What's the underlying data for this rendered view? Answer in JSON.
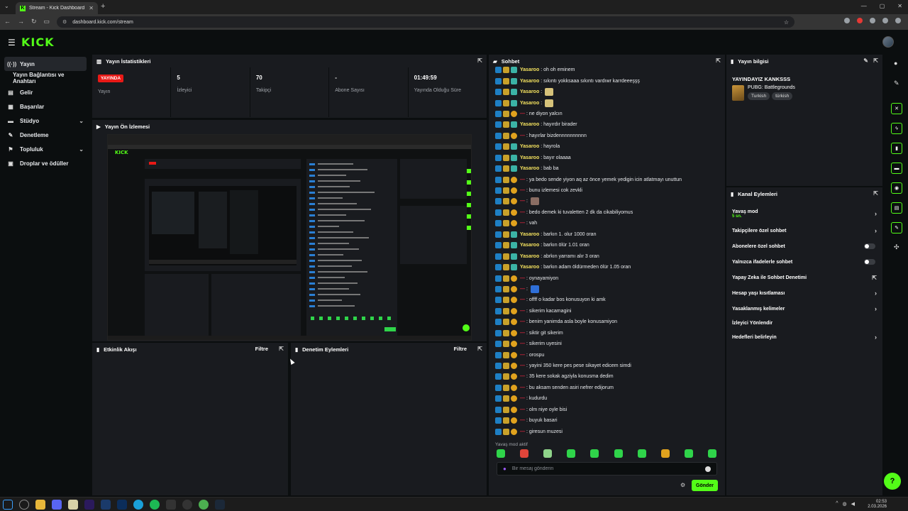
{
  "browser": {
    "tab_title": "Stream - Kick Dashboard",
    "url": "dashboard.kick.com/stream"
  },
  "brand": {
    "logo": "KICK",
    "accent": "#53fc18"
  },
  "sidebar": {
    "items": [
      {
        "label": "Yayın",
        "icon": "broadcast-icon"
      },
      {
        "label": "Yayın Bağlantısı ve Anahtarı"
      },
      {
        "label": "Gelir",
        "icon": "wallet-icon"
      },
      {
        "label": "Başarılar",
        "icon": "trophy-icon"
      },
      {
        "label": "Stüdyo",
        "icon": "studio-icon"
      },
      {
        "label": "Denetleme",
        "icon": "wrench-icon"
      },
      {
        "label": "Topluluk",
        "icon": "community-icon"
      },
      {
        "label": "Droplar ve ödüller",
        "icon": "gift-icon"
      }
    ]
  },
  "stats_panel": {
    "title": "Yayın İstatistikleri",
    "live_badge": "YAYINDA",
    "stats": [
      {
        "value": "",
        "label": "Yayın"
      },
      {
        "value": "5",
        "label": "İzleyici"
      },
      {
        "value": "70",
        "label": "Takipçi"
      },
      {
        "value": "-",
        "label": "Abone Sayısı"
      },
      {
        "value": "01:49:59",
        "label": "Yayında Olduğu Süre"
      }
    ]
  },
  "preview_panel": {
    "title": "Yayın Ön İzlemesi"
  },
  "activity_panel": {
    "title": "Etkinlik Akışı",
    "filter": "Filtre"
  },
  "moderation_panel": {
    "title": "Denetim Eylemleri",
    "filter": "Filtre"
  },
  "chat": {
    "title": "Sohbet",
    "messages": [
      {
        "user": "Yasaroo",
        "color": "y",
        "text": ": oh oh eminem"
      },
      {
        "user": "Yasaroo",
        "color": "y",
        "text": ": sıkıntı yokksaaa sıkıntı vardıwr karrdeeeşşş"
      },
      {
        "user": "Yasaroo",
        "color": "y",
        "text": ":",
        "emote": "#d6c27a"
      },
      {
        "user": "Yasaroo",
        "color": "y",
        "text": ":",
        "emote": "#d6c27a"
      },
      {
        "user": "—",
        "color": "r",
        "text": ": ne diyon yalcın"
      },
      {
        "user": "Yasaroo",
        "color": "y",
        "text": ": hayırdır birader"
      },
      {
        "user": "—",
        "color": "r",
        "text": ": hayırlar bizdennnnnnnnnn"
      },
      {
        "user": "Yasaroo",
        "color": "y",
        "text": ": hayrola"
      },
      {
        "user": "Yasaroo",
        "color": "y",
        "text": ": bayır olaaaa"
      },
      {
        "user": "Yasaroo",
        "color": "y",
        "text": ": bab ba"
      },
      {
        "user": "—",
        "color": "r",
        "text": ": ya bedo sende yiyon aq az önce yemek yedigin icin atlatmayı unuttun"
      },
      {
        "user": "—",
        "color": "r",
        "text": ": bunu izlemesi cok zevkli"
      },
      {
        "user": "—",
        "color": "r",
        "text": ":",
        "emote": "#8a6d63"
      },
      {
        "user": "—",
        "color": "r",
        "text": ": bedo demek ki tuvaletten 2 dk da cikabiliyomus"
      },
      {
        "user": "—",
        "color": "r",
        "text": ": vah"
      },
      {
        "user": "Yasaroo",
        "color": "y",
        "text": ": barkın 1. olur 1000 oran"
      },
      {
        "user": "Yasaroo",
        "color": "y",
        "text": ": barkın ölür 1.01 oran"
      },
      {
        "user": "Yasaroo",
        "color": "y",
        "text": ": abrkın yarramı alır 3 oran"
      },
      {
        "user": "Yasaroo",
        "color": "y",
        "text": ": barkın adam öldürmeden ölür 1.05 oran"
      },
      {
        "user": "—",
        "color": "r",
        "text": ": oynayamiyon"
      },
      {
        "user": "—",
        "color": "r",
        "text": ":",
        "emote": "#2f6fd8"
      },
      {
        "user": "—",
        "color": "r",
        "text": ": offff o kadar bos konusuyon ki amk"
      },
      {
        "user": "—",
        "color": "r",
        "text": ": sikerim kacamagini"
      },
      {
        "user": "—",
        "color": "r",
        "text": ": benim yanimda asla boyle konusamiyon"
      },
      {
        "user": "—",
        "color": "r",
        "text": ": siktir git sikerim"
      },
      {
        "user": "—",
        "color": "r",
        "text": ": sikerim uyesini"
      },
      {
        "user": "—",
        "color": "r",
        "text": ": orospu"
      },
      {
        "user": "—",
        "color": "r",
        "text": ": yayini 350 kere pes pese sikayet edicem simdi"
      },
      {
        "user": "—",
        "color": "r",
        "text": ": 35 kere sokak agziyla konusma dedim"
      },
      {
        "user": "—",
        "color": "r",
        "text": ": bu aksam senden asiri nefrer edijorum"
      },
      {
        "user": "—",
        "color": "r",
        "text": ": kudurdu"
      },
      {
        "user": "—",
        "color": "r",
        "text": ": olm niye oyle bisi"
      },
      {
        "user": "—",
        "color": "r",
        "text": ": buyuk basari"
      },
      {
        "user": "—",
        "color": "r",
        "text": ": giresun muzesi"
      }
    ],
    "slow_mode_note": "Yavaş mod aktif",
    "input_placeholder": "Bir mesaj gönderin",
    "send_label": "Gönder"
  },
  "stream_info": {
    "title": "Yayın bilgisi",
    "stream_title": "YAYINDAYIZ KANKSSS",
    "game": "PUBG: Battlegrounds",
    "tags": [
      "Turkish",
      "türkish"
    ]
  },
  "channel_actions": {
    "title": "Kanal Eylemleri",
    "items": [
      {
        "label": "Yavaş mod",
        "sub": "5 sn.",
        "control": "chevron"
      },
      {
        "label": "Takipçilere özel sohbet",
        "control": "chevron"
      },
      {
        "label": "Abonelere özel sohbet",
        "control": "toggle"
      },
      {
        "label": "Yalnızca ifadelerle sohbet",
        "control": "toggle"
      },
      {
        "label": "Yapay Zeka ile Sohbet Denetimi",
        "control": "external"
      },
      {
        "label": "Hesap yaşı kısıtlaması",
        "control": "chevron"
      },
      {
        "label": "Yasaklanmış kelimeler",
        "control": "chevron"
      },
      {
        "label": "İzleyici Yönlendir",
        "control": "none"
      },
      {
        "label": "Hedefleri belirleyin",
        "control": "chevron"
      }
    ]
  },
  "taskbar": {
    "time": "02:53",
    "date": "2.03.2026"
  }
}
